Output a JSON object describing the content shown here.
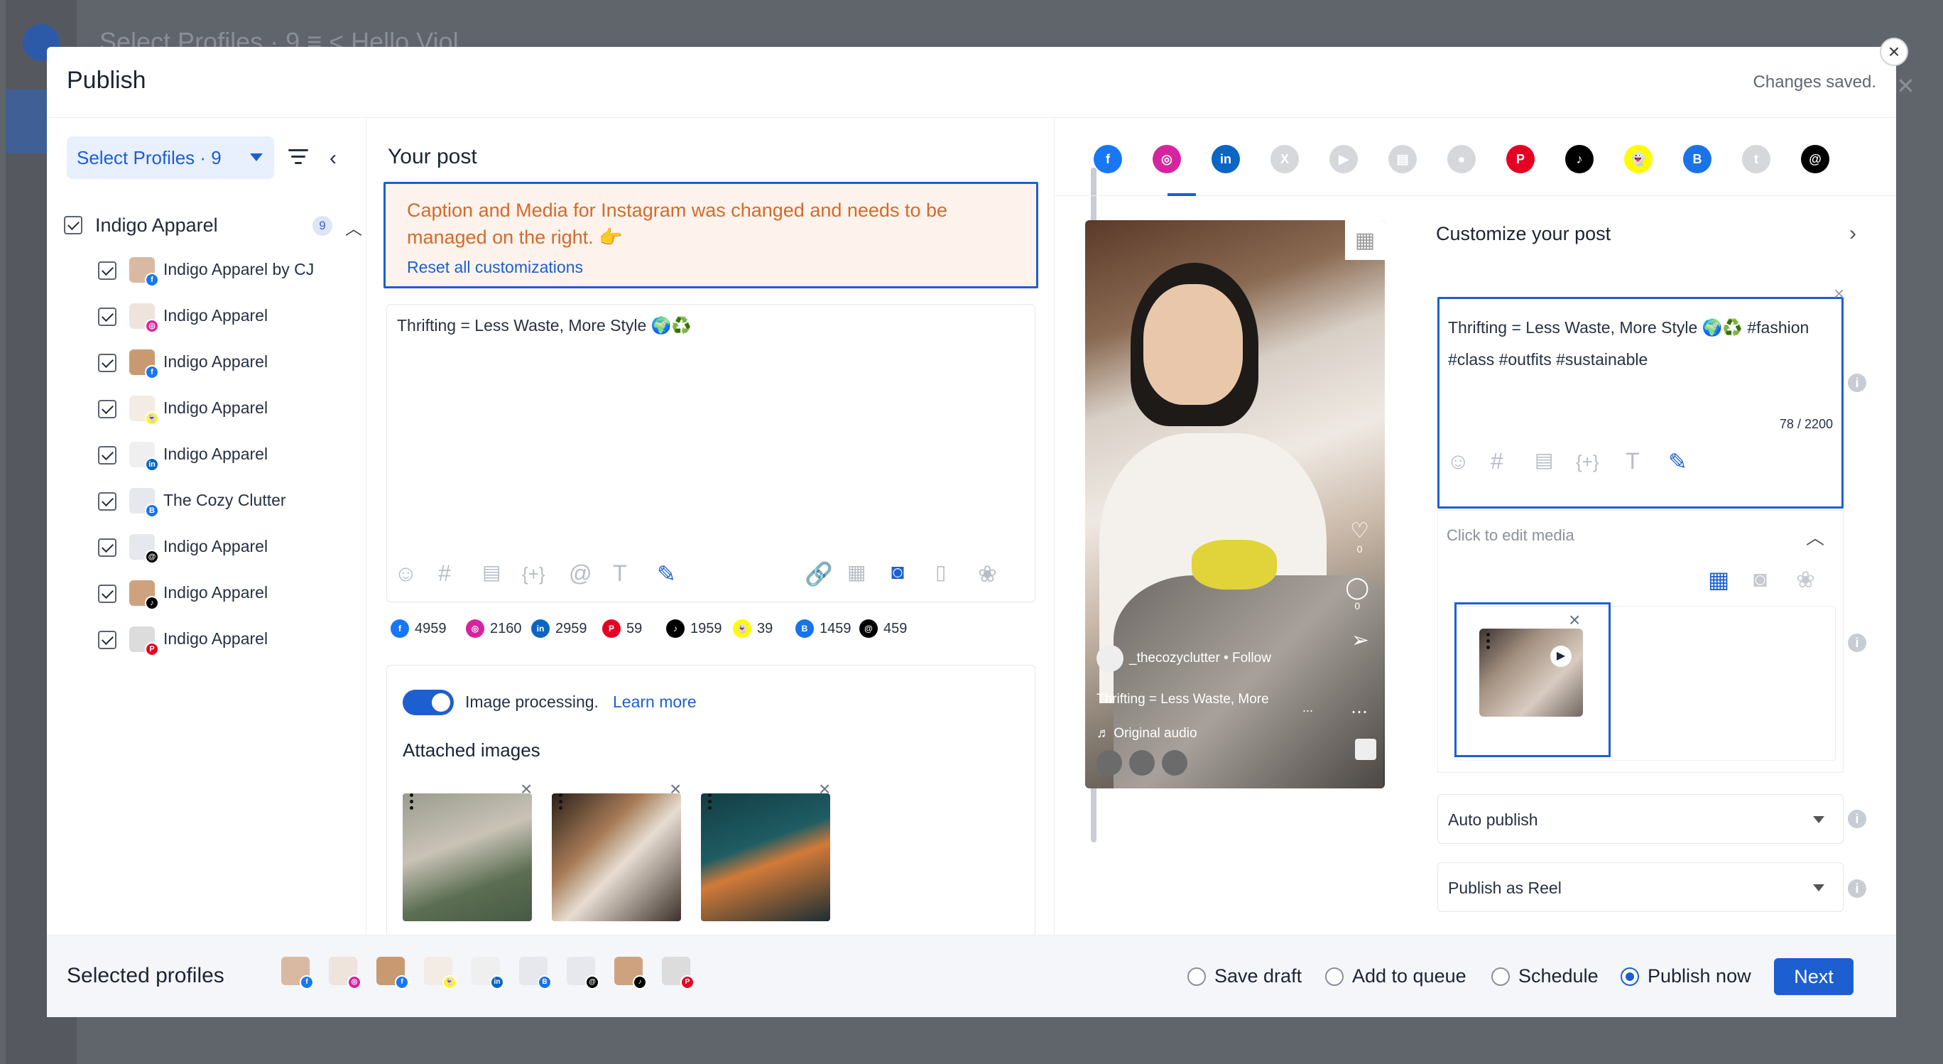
{
  "background": {
    "top_text": "Select Profiles · 9     ≡   <     Hello Viol"
  },
  "modal": {
    "title": "Publish",
    "status": "Changes saved."
  },
  "left_panel": {
    "select_profiles_label": "Select Profiles · 9",
    "group": {
      "label": "Indigo Apparel",
      "count": "9"
    },
    "profiles": [
      {
        "label": "Indigo Apparel by CJ",
        "network": "facebook",
        "badge_color": "#1877f2",
        "badge_text": "f"
      },
      {
        "label": "Indigo Apparel",
        "network": "instagram",
        "badge_color": "#d6249f",
        "badge_text": "◎"
      },
      {
        "label": "Indigo Apparel",
        "network": "facebook",
        "badge_color": "#1877f2",
        "badge_text": "f"
      },
      {
        "label": "Indigo Apparel",
        "network": "snapchat",
        "badge_color": "#fffc00",
        "badge_text": "👻"
      },
      {
        "label": "Indigo Apparel",
        "network": "linkedin",
        "badge_color": "#0a66c2",
        "badge_text": "in"
      },
      {
        "label": "The Cozy Clutter",
        "network": "google-business",
        "badge_color": "#1a73e8",
        "badge_text": "B"
      },
      {
        "label": "Indigo Apparel",
        "network": "threads",
        "badge_color": "#000000",
        "badge_text": "@"
      },
      {
        "label": "Indigo Apparel",
        "network": "tiktok",
        "badge_color": "#000000",
        "badge_text": "♪"
      },
      {
        "label": "Indigo Apparel",
        "network": "pinterest",
        "badge_color": "#e60023",
        "badge_text": "P"
      }
    ]
  },
  "post": {
    "title": "Your post",
    "warning": "Caption and Media for Instagram was changed and needs to be managed on the right. 👉",
    "reset_link": "Reset all customizations",
    "caption": "Thrifting = Less Waste, More Style 🌍♻️",
    "char_counts": [
      {
        "network": "facebook",
        "value": "4959",
        "color": "#1877f2",
        "icon": "f"
      },
      {
        "network": "instagram",
        "value": "2160",
        "color": "#d6249f",
        "icon": "◎"
      },
      {
        "network": "linkedin",
        "value": "2959",
        "color": "#0a66c2",
        "icon": "in"
      },
      {
        "network": "pinterest",
        "value": "59",
        "color": "#e60023",
        "icon": "P"
      },
      {
        "network": "tiktok",
        "value": "1959",
        "color": "#000000",
        "icon": "♪"
      },
      {
        "network": "snapchat",
        "value": "39",
        "color": "#fffc00",
        "icon": "👻"
      },
      {
        "network": "google-business",
        "value": "1459",
        "color": "#1a73e8",
        "icon": "B"
      },
      {
        "network": "threads",
        "value": "459",
        "color": "#000000",
        "icon": "@"
      }
    ],
    "image_processing_label": "Image processing.",
    "learn_more": "Learn more",
    "attached_images_title": "Attached images"
  },
  "preview": {
    "networks": [
      {
        "name": "facebook",
        "color": "#1877f2",
        "glyph": "f"
      },
      {
        "name": "instagram",
        "color": "#d6249f",
        "glyph": "◎"
      },
      {
        "name": "linkedin",
        "color": "#0a66c2",
        "glyph": "in"
      },
      {
        "name": "x",
        "color": "#d5d7db",
        "glyph": "X"
      },
      {
        "name": "youtube",
        "color": "#d5d7db",
        "glyph": "▶"
      },
      {
        "name": "google-docs",
        "color": "#d5d7db",
        "glyph": "▤"
      },
      {
        "name": "reddit",
        "color": "#d5d7db",
        "glyph": "●"
      },
      {
        "name": "pinterest",
        "color": "#e60023",
        "glyph": "P"
      },
      {
        "name": "tiktok",
        "color": "#000000",
        "glyph": "♪"
      },
      {
        "name": "snapchat",
        "color": "#fffc00",
        "glyph": "👻"
      },
      {
        "name": "google-business",
        "color": "#1a73e8",
        "glyph": "B"
      },
      {
        "name": "tumblr",
        "color": "#d5d7db",
        "glyph": "t"
      },
      {
        "name": "threads",
        "color": "#000000",
        "glyph": "@"
      }
    ],
    "username": "_thecozyclutter",
    "follow": "• Follow",
    "caption": "Thrifting = Less Waste, More",
    "audio": "♬ Original audio",
    "likes": "0",
    "comments": "0"
  },
  "customize": {
    "title": "Customize your post",
    "caption": "Thrifting = Less Waste, More Style 🌍♻️ #fashion #class #outfits #sustainable",
    "char_count": "78 / 2200",
    "media_title": "Click to edit media",
    "auto_publish": "Auto publish",
    "publish_as": "Publish as Reel"
  },
  "footer": {
    "title": "Selected profiles",
    "options": [
      "Save draft",
      "Add to queue",
      "Schedule",
      "Publish now"
    ],
    "selected_option": "Publish now",
    "next": "Next"
  }
}
